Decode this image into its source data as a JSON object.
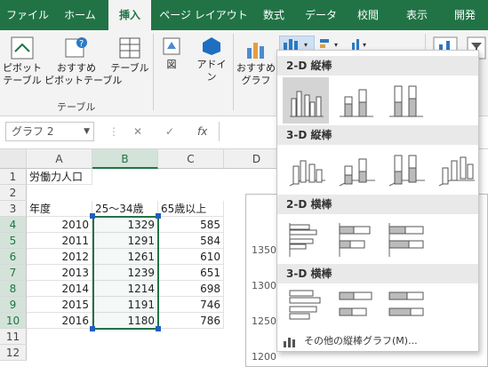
{
  "tabs": [
    "ファイル",
    "ホーム",
    "挿入",
    "ページ レイアウト",
    "数式",
    "データ",
    "校閲",
    "表示",
    "開発"
  ],
  "ribbon": {
    "pivot": "ピボット\nテーブル",
    "recommended_pivot": "おすすめ\nピボットテーブル",
    "table": "テーブル",
    "illustrations": "図",
    "addins": "アドイ\nン",
    "recommended_charts": "おすすめ\nグラフ",
    "group_table": "テーブル"
  },
  "formula_bar": {
    "name_box": "グラフ 2",
    "fx": "fx",
    "cancel": "✕",
    "enter": "✓"
  },
  "sheet": {
    "columns": [
      "A",
      "B",
      "C",
      "D"
    ],
    "rows": [
      "1",
      "2",
      "3",
      "4",
      "5",
      "6",
      "7",
      "8",
      "9",
      "10",
      "11",
      "12"
    ],
    "title": "労働力人口",
    "headers": [
      "年度",
      "25～34歳",
      "65歳以上"
    ],
    "data": [
      [
        "2010",
        "1329",
        "585"
      ],
      [
        "2011",
        "1291",
        "584"
      ],
      [
        "2012",
        "1261",
        "610"
      ],
      [
        "2013",
        "1239",
        "651"
      ],
      [
        "2014",
        "1214",
        "698"
      ],
      [
        "2015",
        "1191",
        "746"
      ],
      [
        "2016",
        "1180",
        "786"
      ]
    ]
  },
  "chart_preview": {
    "yticks": [
      "1350",
      "1300",
      "1250",
      "1200"
    ]
  },
  "dropdown": {
    "sections": [
      "2-D 縦棒",
      "3-D 縦棒",
      "2-D 横棒",
      "3-D 横棒"
    ],
    "footer": "その他の縦棒グラフ(M)..."
  },
  "colors": {
    "accent": "#217346",
    "selection": "#1f5fbf"
  }
}
